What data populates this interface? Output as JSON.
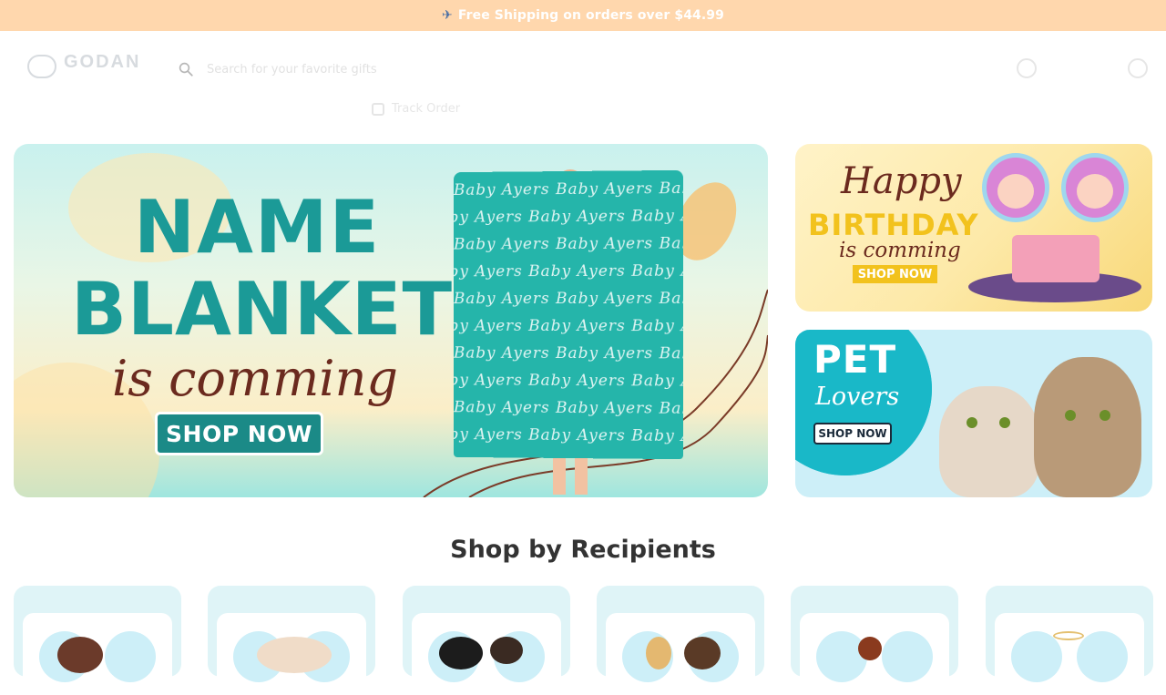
{
  "announcement": {
    "icon": "airplane-icon",
    "text": "Free Shipping on orders over $44.99"
  },
  "header": {
    "logo_word": "GODAN",
    "search_placeholder": "Search for your favorite gifts"
  },
  "subnav": {
    "label": "Track Order"
  },
  "hero": {
    "line1": "NAME",
    "line2": "BLANKET",
    "line3": "is comming",
    "cta": "SHOP NOW",
    "blanket_pattern": "Baby  Ayers  Baby  Ayers  Baby  Ayers  Baby"
  },
  "promo_birthday": {
    "line1": "Happy",
    "line2": "BIRTHDAY",
    "line3": "is comming",
    "cta": "SHOP NOW"
  },
  "promo_pet": {
    "line1": "PET",
    "line2": "Lovers",
    "cta": "SHOP NOW"
  },
  "recipients": {
    "title": "Shop by Recipients",
    "cards": [
      {
        "name": "recipient-card-1"
      },
      {
        "name": "recipient-card-2"
      },
      {
        "name": "recipient-card-3"
      },
      {
        "name": "recipient-card-4"
      },
      {
        "name": "recipient-card-5"
      },
      {
        "name": "recipient-card-6"
      }
    ]
  },
  "colors": {
    "announcement_bg": "#ffd7ad",
    "brand_teal": "#1b9a97",
    "card_bg": "#dff4f7"
  }
}
